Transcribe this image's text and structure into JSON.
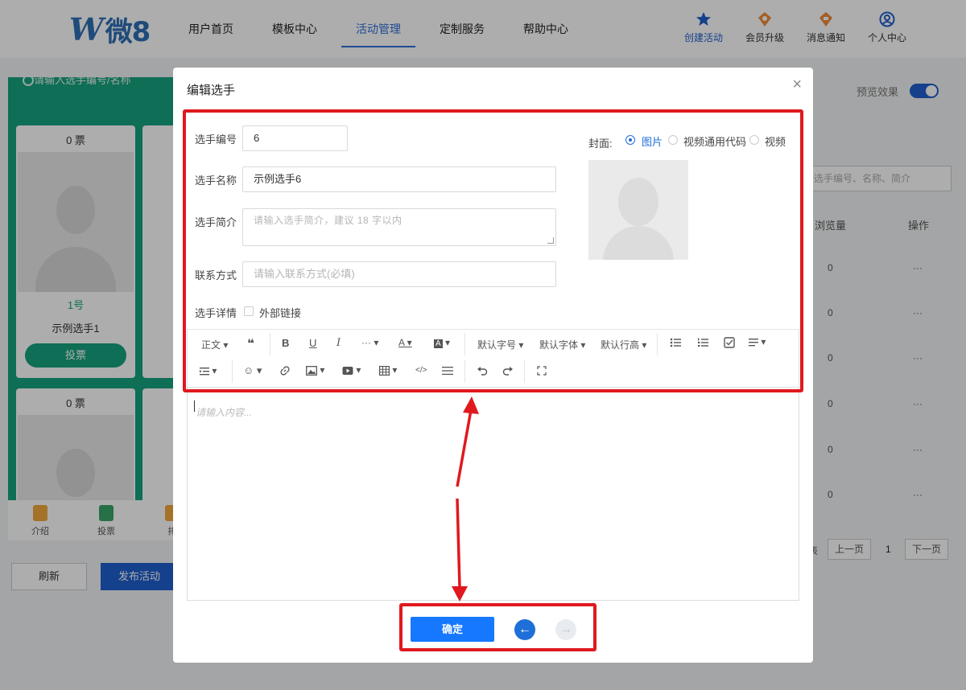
{
  "header": {
    "logo_w": "W",
    "logo_text": "微8",
    "nav": [
      "用户首页",
      "模板中心",
      "活动管理",
      "定制服务",
      "帮助中心"
    ],
    "actions": [
      {
        "label": "创建活动",
        "icon": "star-icon",
        "color": "#1f5fcf"
      },
      {
        "label": "会员升级",
        "icon": "crown-icon",
        "color": "#f08c3a"
      },
      {
        "label": "消息通知",
        "icon": "bell-icon",
        "color": "#f08c3a"
      },
      {
        "label": "个人中心",
        "icon": "user-icon",
        "color": "#1f5fcf"
      }
    ]
  },
  "background": {
    "search_placeholder": "请输入选手编号/名称",
    "cards": [
      {
        "votes": "0 票",
        "num": "1号",
        "name": "示例选手1",
        "vote_btn": "投票"
      },
      {
        "votes": "0 票"
      }
    ],
    "bottom_tabs": [
      "介绍",
      "投票",
      "排"
    ],
    "refresh": "刷新",
    "publish": "发布活动",
    "preview_label": "预览效果",
    "table_search_placeholder": "选手编号、名称、简介",
    "col_views": "浏览量",
    "col_actions": "操作",
    "row_views": [
      "0",
      "0",
      "0",
      "0",
      "0",
      "0"
    ],
    "row_more": "···",
    "pager": {
      "prev": "上一页",
      "page": "1",
      "next": "下一页",
      "left_char": "表"
    }
  },
  "modal": {
    "title": "编辑选手",
    "close": "×",
    "fields": {
      "number_label": "选手编号",
      "number_value": "6",
      "name_label": "选手名称",
      "name_value": "示例选手6",
      "intro_label": "选手简介",
      "intro_placeholder": "请输入选手简介，建议 18 字以内",
      "contact_label": "联系方式",
      "contact_placeholder": "请输入联系方式(必填)",
      "detail_label": "选手详情",
      "external_link_label": "外部链接"
    },
    "cover": {
      "label": "封面:",
      "options": [
        "图片",
        "视频通用代码",
        "视频"
      ],
      "selected": "图片"
    },
    "toolbar": {
      "row1": [
        "正文",
        "❝",
        "B",
        "U",
        "I",
        "···",
        "A",
        "A",
        "默认字号",
        "默认字体",
        "默认行高"
      ],
      "editor_placeholder": "请输入内容..."
    },
    "confirm": "确定",
    "prev_icon": "←",
    "next_icon": "→"
  },
  "colors": {
    "primary": "#1677ff",
    "annotation": "#e0191e",
    "phone_green": "#16a37f"
  }
}
